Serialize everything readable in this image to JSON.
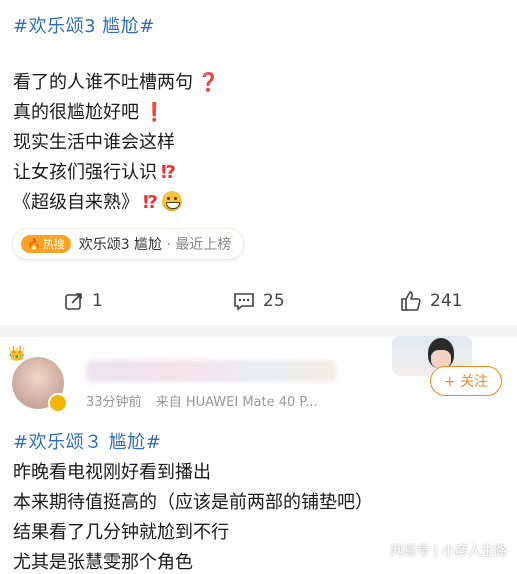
{
  "post1": {
    "hashtag": "#欢乐颂3 尴尬#",
    "lines": [
      "看了的人谁不吐槽两句",
      "真的很尴尬好吧",
      "现实生活中谁会这样",
      "让女孩们强行认识",
      "《超级自来熟》"
    ],
    "hot": {
      "badge": "热搜",
      "topic": "欢乐颂3 尴尬",
      "status": "· 最近上榜"
    },
    "actions": {
      "repost": "1",
      "comments": "25",
      "likes": "241"
    }
  },
  "post2": {
    "time": "33分钟前",
    "source": "来自 HUAWEI Mate 40 P...",
    "follow_label": "+ 关注",
    "hashtag": "#欢乐颂３ 尴尬#",
    "lines": [
      "昨晚看电视刚好看到播出",
      "本来期待值挺高的（应该是前两部的铺垫吧）",
      "结果看了几分钟就尬到不行",
      "尤其是张慧雯那个角色"
    ]
  },
  "watermark": "网易号 | 小彦人生路",
  "colors": {
    "link": "#2f6db5",
    "hot": "#f7a326",
    "follow": "#f08a24"
  }
}
